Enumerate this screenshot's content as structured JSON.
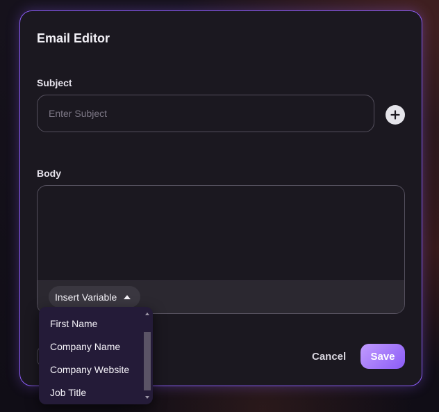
{
  "dialog": {
    "title": "Email Editor"
  },
  "subject": {
    "label": "Subject",
    "placeholder": "Enter Subject",
    "value": ""
  },
  "body": {
    "label": "Body",
    "value": "",
    "insert_variable_label": "Insert Variable"
  },
  "variables": {
    "items": [
      {
        "label": "First Name"
      },
      {
        "label": "Company Name"
      },
      {
        "label": "Company Website"
      },
      {
        "label": "Job Title"
      }
    ]
  },
  "footer": {
    "cancel_label": "Cancel",
    "save_label": "Save"
  },
  "colors": {
    "accent": "#8b5cf6",
    "dialog_bg": "#1b1820",
    "dropdown_bg": "#241b38"
  },
  "icons": {
    "add": "plus-circle-icon",
    "insert_variable_caret": "caret-up-icon"
  }
}
